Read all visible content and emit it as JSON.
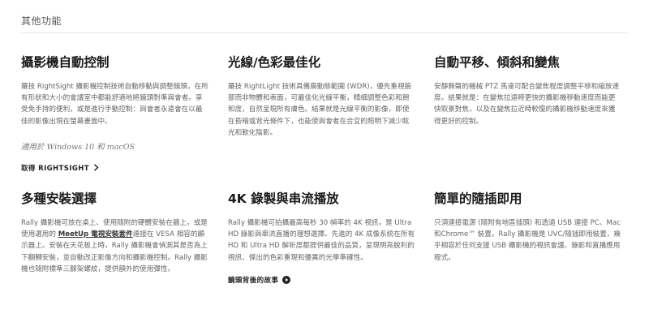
{
  "section": {
    "title": "其他功能"
  },
  "features": [
    {
      "heading": "攝影機自動控制",
      "body": "羅技 RightSight 攝影機控制技術自動移動與調整鏡頭，在所有形狀和大小的會議室中都能舒適地將鏡頭對準與會者。享受免手持的便利，或是進行手動控制：與會者永遠會在以最佳的影像出現在螢幕畫面中。",
      "note": "適用於 Windows 10 和 macOS",
      "link_label": "取得 RIGHTSIGHT",
      "link_icon": "chevron-right-icon"
    },
    {
      "heading": "光線/色彩最佳化",
      "body": "羅技 RightLight 技術具備廣動態範圍 (WDR)，優先重視臉部而非物體和表面，可最佳化光線平衡，精細調整色彩和飽和度，自然呈現所有膚色。結果就是光線平衡的影像，即使在昏暗或背光條件下，也能使與會者在合宜的照明下減少眩光和軟化陰影。"
    },
    {
      "heading": "自動平移、傾斜和變焦",
      "body": "安靜無聲的機械 PTZ 馬達可配合變焦程度調整平移和縮放速度。結果就是：在變焦拉遠時更快的攝影機移動速度而能更快取景對焦，以及在變焦拉近時較慢的攝影機移動速度來獲得更好的控制。"
    },
    {
      "heading": "多種安裝選擇",
      "body_before": "Rally 攝影機可放在桌上、使用隨附的硬體安裝在牆上，或是使用選用的 ",
      "body_link": "MeetUp 電視安裝套件",
      "body_after": "連接在 VESA 相容的顯示器上。安裝在天花板上時，Rally 攝影機會偵測其是否為上下翻轉安裝，並自動改正影像方向和攝影機控制。Rally 攝影機也隨附標準三腳架螺紋，提供額外的使用彈性。"
    },
    {
      "heading": "4K 錄製與串流播放",
      "body": "Rally 攝影機可拍攝最高每秒 30 幀率的 4K 視訊，是 Ultra HD 錄影與串流直播的理想選擇。先進的 4K 成像系統在所有 HD 和 Ultra HD 解析度都提供最佳的品質，呈現明亮銳利的視訊、傑出的色彩重現和優異的光學準確性。",
      "link_label": "鏡頭背後的故事",
      "link_icon": "play-circle-icon"
    },
    {
      "heading": "簡單的隨插即用",
      "body": "只須連接電源 (隨附有地區插頭) 和透過 USB 連接 PC、Mac 和Chrome™ 裝置。Rally 攝影機是 UVC/隨插即用裝置，幾乎相容於任何支援 USB 攝影機的視訊會議、錄影和直播應用程式。"
    }
  ]
}
